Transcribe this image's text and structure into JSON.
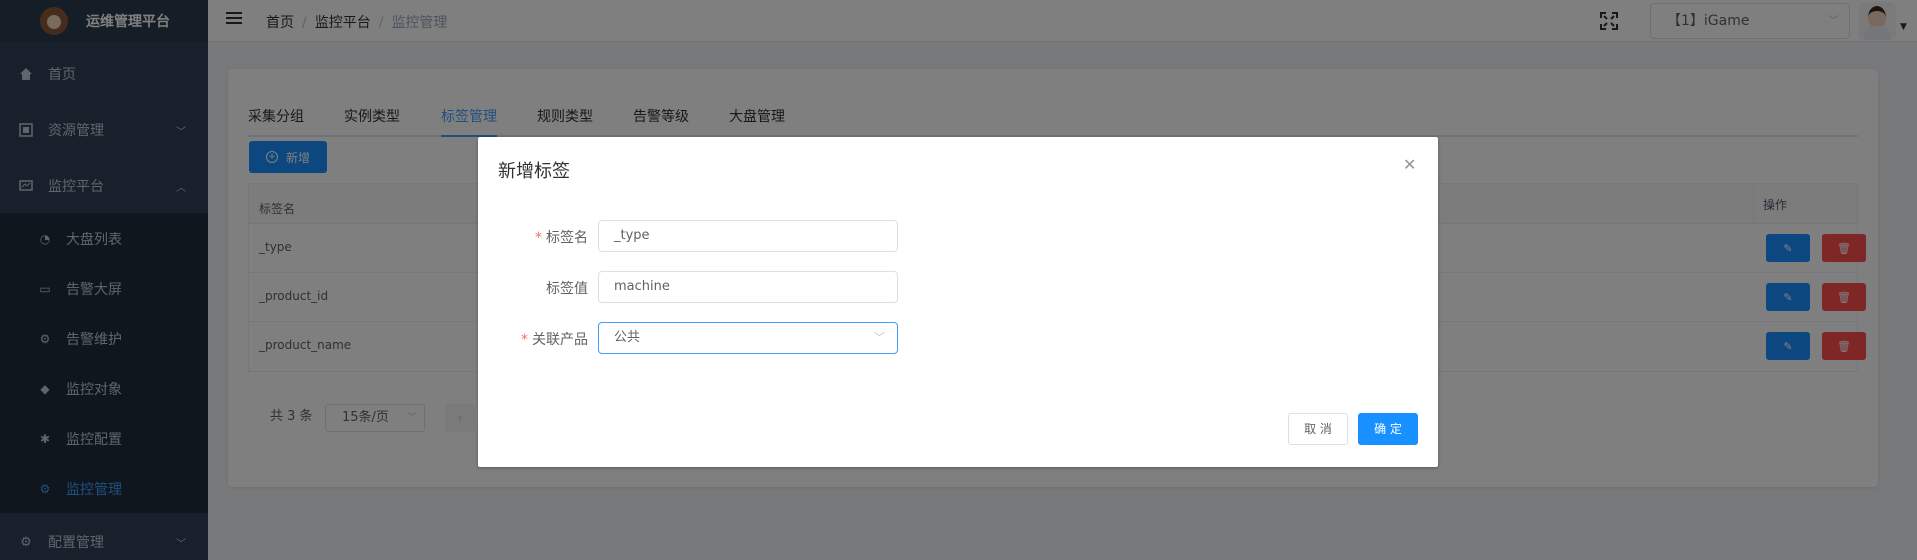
{
  "app": {
    "title": "运维管理平台"
  },
  "sidebar": {
    "items": [
      {
        "label": "首页",
        "icon": "home-icon"
      },
      {
        "label": "资源管理",
        "icon": "server-icon",
        "expanded": false
      },
      {
        "label": "监控平台",
        "icon": "monitor-icon",
        "expanded": true
      },
      {
        "label": "配置管理",
        "icon": "gear-icon",
        "expanded": false
      }
    ],
    "submenu": [
      {
        "label": "大盘列表",
        "icon": "dashboard-icon"
      },
      {
        "label": "告警大屏",
        "icon": "screen-icon"
      },
      {
        "label": "告警维护",
        "icon": "wrench-icon"
      },
      {
        "label": "监控对象",
        "icon": "target-icon"
      },
      {
        "label": "监控配置",
        "icon": "config-icon"
      },
      {
        "label": "监控管理",
        "icon": "settings-icon",
        "active": true
      }
    ]
  },
  "breadcrumb": [
    "首页",
    "监控平台",
    "监控管理"
  ],
  "header": {
    "project_select": "【1】iGame"
  },
  "tabs": [
    {
      "label": "采集分组"
    },
    {
      "label": "实例类型"
    },
    {
      "label": "标签管理",
      "active": true
    },
    {
      "label": "规则类型"
    },
    {
      "label": "告警等级"
    },
    {
      "label": "大盘管理"
    }
  ],
  "toolbar": {
    "add_label": "新增"
  },
  "table": {
    "columns": [
      "标签名",
      "操作"
    ],
    "rows": [
      {
        "name": "_type"
      },
      {
        "name": "_product_id"
      },
      {
        "name": "_product_name"
      }
    ]
  },
  "pagination": {
    "total": "共 3 条",
    "page_size": "15条/页"
  },
  "dialog": {
    "title": "新增标签",
    "fields": [
      {
        "label": "标签名",
        "required": true,
        "value": "_type"
      },
      {
        "label": "标签值",
        "required": false,
        "value": "machine"
      },
      {
        "label": "关联产品",
        "required": true,
        "value": "公共"
      }
    ],
    "cancel_label": "取 消",
    "ok_label": "确 定"
  },
  "colors": {
    "sidebar_bg": "#304156",
    "accent": "#1890ff",
    "danger": "#ff4d4f"
  }
}
